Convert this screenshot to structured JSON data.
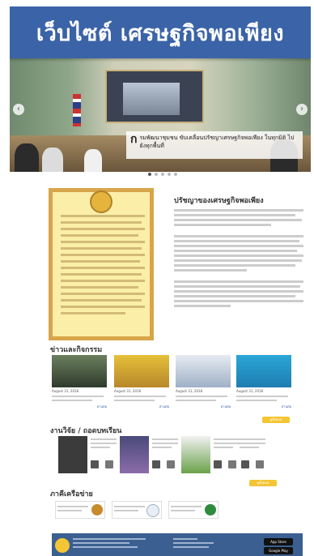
{
  "banner": {
    "title": "เว็บไซต์ เศรษฐกิจพอเพียง"
  },
  "hero": {
    "caption_initial": "ก",
    "caption": "รมพัฒนาชุมชน ขับเคลื่อนปรัชญาเศรษฐกิจพอเพียง ในทุกมิติ ไปยังทุกพื้นที่",
    "arrow_prev": "‹",
    "arrow_next": "›",
    "slides": 5,
    "active_slide": 1
  },
  "philosophy": {
    "heading": "ปรัชญาของเศรษฐกิจพอเพียง"
  },
  "sections": {
    "news": "ข่าวและกิจกรรม",
    "publications": "งานวิจัย / ถอดบทเรียน",
    "partners": "ภาคีเครือข่าย"
  },
  "news": [
    {
      "date": "August 31, 2018",
      "more": "อ่านต่อ"
    },
    {
      "date": "August 31, 2018",
      "more": "อ่านต่อ"
    },
    {
      "date": "August 31, 2018",
      "more": "อ่านต่อ"
    },
    {
      "date": "August 31, 2018",
      "more": "อ่านต่อ"
    }
  ],
  "buttons": {
    "news_all": "ดูทั้งหมด",
    "publications_all": "ดูทั้งหมด"
  },
  "footer": {
    "app_store": "App Store",
    "google_play": "Google Play"
  },
  "colors": {
    "brand": "#3b63a7",
    "accent": "#f4c534",
    "footer": "#3b5f90"
  }
}
